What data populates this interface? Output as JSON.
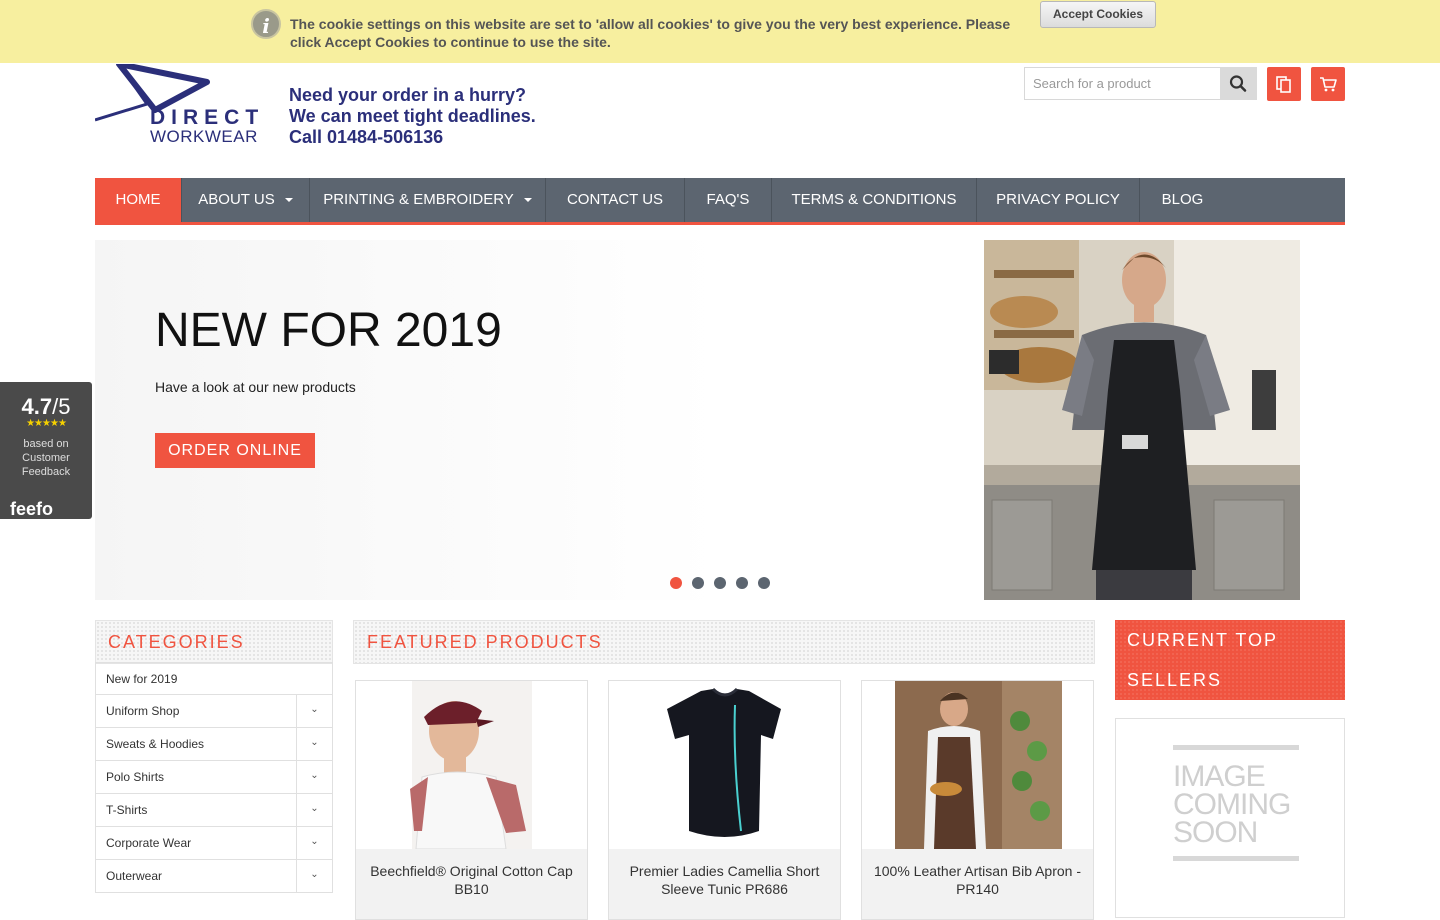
{
  "cookie": {
    "text": "The cookie settings on this website are set to 'allow all cookies' to give you the very best experience. Please click Accept Cookies to continue to use the site.",
    "accept_label": "Accept Cookies"
  },
  "header": {
    "logo_line1": "DIRECT",
    "logo_line2": "WORKWEAR",
    "tagline_line1": "Need your order in a hurry?",
    "tagline_line2": "We can meet tight deadlines.",
    "tagline_line3": "Call 01484-506136",
    "search_placeholder": "Search for a product"
  },
  "nav": {
    "items": [
      {
        "label": "HOME"
      },
      {
        "label": "ABOUT US"
      },
      {
        "label": "PRINTING & EMBROIDERY"
      },
      {
        "label": "CONTACT US"
      },
      {
        "label": "FAQ'S"
      },
      {
        "label": "TERMS & CONDITIONS"
      },
      {
        "label": "PRIVACY POLICY"
      },
      {
        "label": "BLOG"
      }
    ]
  },
  "hero": {
    "title": "NEW FOR 2019",
    "subtitle": "Have a look at our new products",
    "button": "ORDER ONLINE",
    "slide_count": 5,
    "active_slide": 1
  },
  "feefo": {
    "score": "4.7",
    "out_of": "/5",
    "stars": "★★★★★",
    "note": "based on Customer Feedback",
    "logo": "feefo"
  },
  "categories": {
    "heading": "CATEGORIES",
    "items": [
      {
        "label": "New for 2019"
      },
      {
        "label": "Uniform Shop"
      },
      {
        "label": "Sweats & Hoodies"
      },
      {
        "label": "Polo Shirts"
      },
      {
        "label": "T-Shirts"
      },
      {
        "label": "Corporate Wear"
      },
      {
        "label": "Outerwear"
      }
    ]
  },
  "featured": {
    "heading": "FEATURED PRODUCTS",
    "products": [
      {
        "name": "Beechfield® Original Cotton Cap BB10"
      },
      {
        "name": "Premier Ladies Camellia Short Sleeve Tunic PR686"
      },
      {
        "name": "100% Leather Artisan Bib Apron - PR140"
      }
    ]
  },
  "top_sellers": {
    "heading": "CURRENT TOP SELLERS",
    "placeholder": "IMAGE COMING SOON"
  },
  "colors": {
    "accent": "#f05440",
    "nav": "#5c6570",
    "brand": "#2b2f7a",
    "cookie_bg": "#f7ef9f"
  }
}
